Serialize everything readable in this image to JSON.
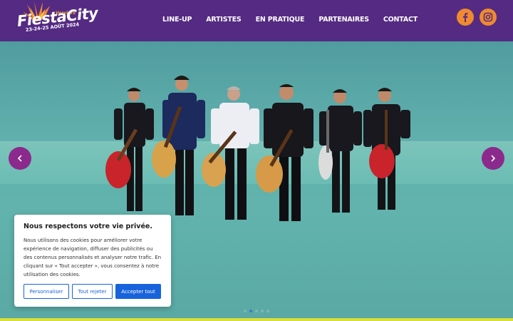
{
  "header": {
    "logo": {
      "city": "Verviers",
      "name": "FiestaCity",
      "dates": "23-24-25 AOÛT 2024"
    },
    "nav": [
      {
        "label": "LINE-UP"
      },
      {
        "label": "ARTISTES"
      },
      {
        "label": "EN PRATIQUE"
      },
      {
        "label": "PARTENAIRES"
      },
      {
        "label": "CONTACT"
      }
    ],
    "social": [
      {
        "icon": "facebook-icon"
      },
      {
        "icon": "instagram-icon"
      }
    ],
    "colors": {
      "background": "#542a82",
      "accent": "#ef8a2e"
    }
  },
  "hero": {
    "carousel": {
      "slide_count": 5,
      "active_index": 1,
      "prev_icon": "chevron-left-icon",
      "next_icon": "chevron-right-icon"
    },
    "colors": {
      "arrow": "#8b2a8c",
      "background": "#5fb0ad"
    }
  },
  "cookie_banner": {
    "title": "Nous respectons votre vie privée.",
    "text": "Nous utilisons des cookies pour améliorer votre expérience de navigation, diffuser des publicités ou des contenus personnalisés et analyser notre trafic. En cliquant sur « Tout accepter », vous consentez à notre utilisation des cookies.",
    "buttons": {
      "customize": "Personnaliser",
      "reject": "Tout rejeter",
      "accept": "Accepter tout"
    },
    "colors": {
      "primary": "#1863dc"
    }
  }
}
